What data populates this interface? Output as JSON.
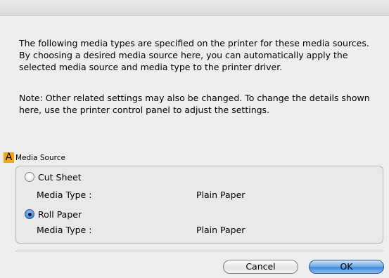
{
  "description": "The following media types are specified on the printer for these media sources. By choosing a desired media source here, you can automatically apply the selected media source and media type to the printer driver.",
  "note": "Note: Other related settings may also be changed. To change the details shown here, use the printer control panel to adjust the settings.",
  "marker_label": "A",
  "marker_color": "#f5a60c",
  "group_label": "Media Source",
  "options": [
    {
      "label": "Cut Sheet",
      "selected": false,
      "media_type_label": "Media Type :",
      "media_type_value": "Plain Paper"
    },
    {
      "label": "Roll Paper",
      "selected": true,
      "media_type_label": "Media Type :",
      "media_type_value": "Plain Paper"
    }
  ],
  "buttons": {
    "cancel": "Cancel",
    "ok": "OK"
  }
}
